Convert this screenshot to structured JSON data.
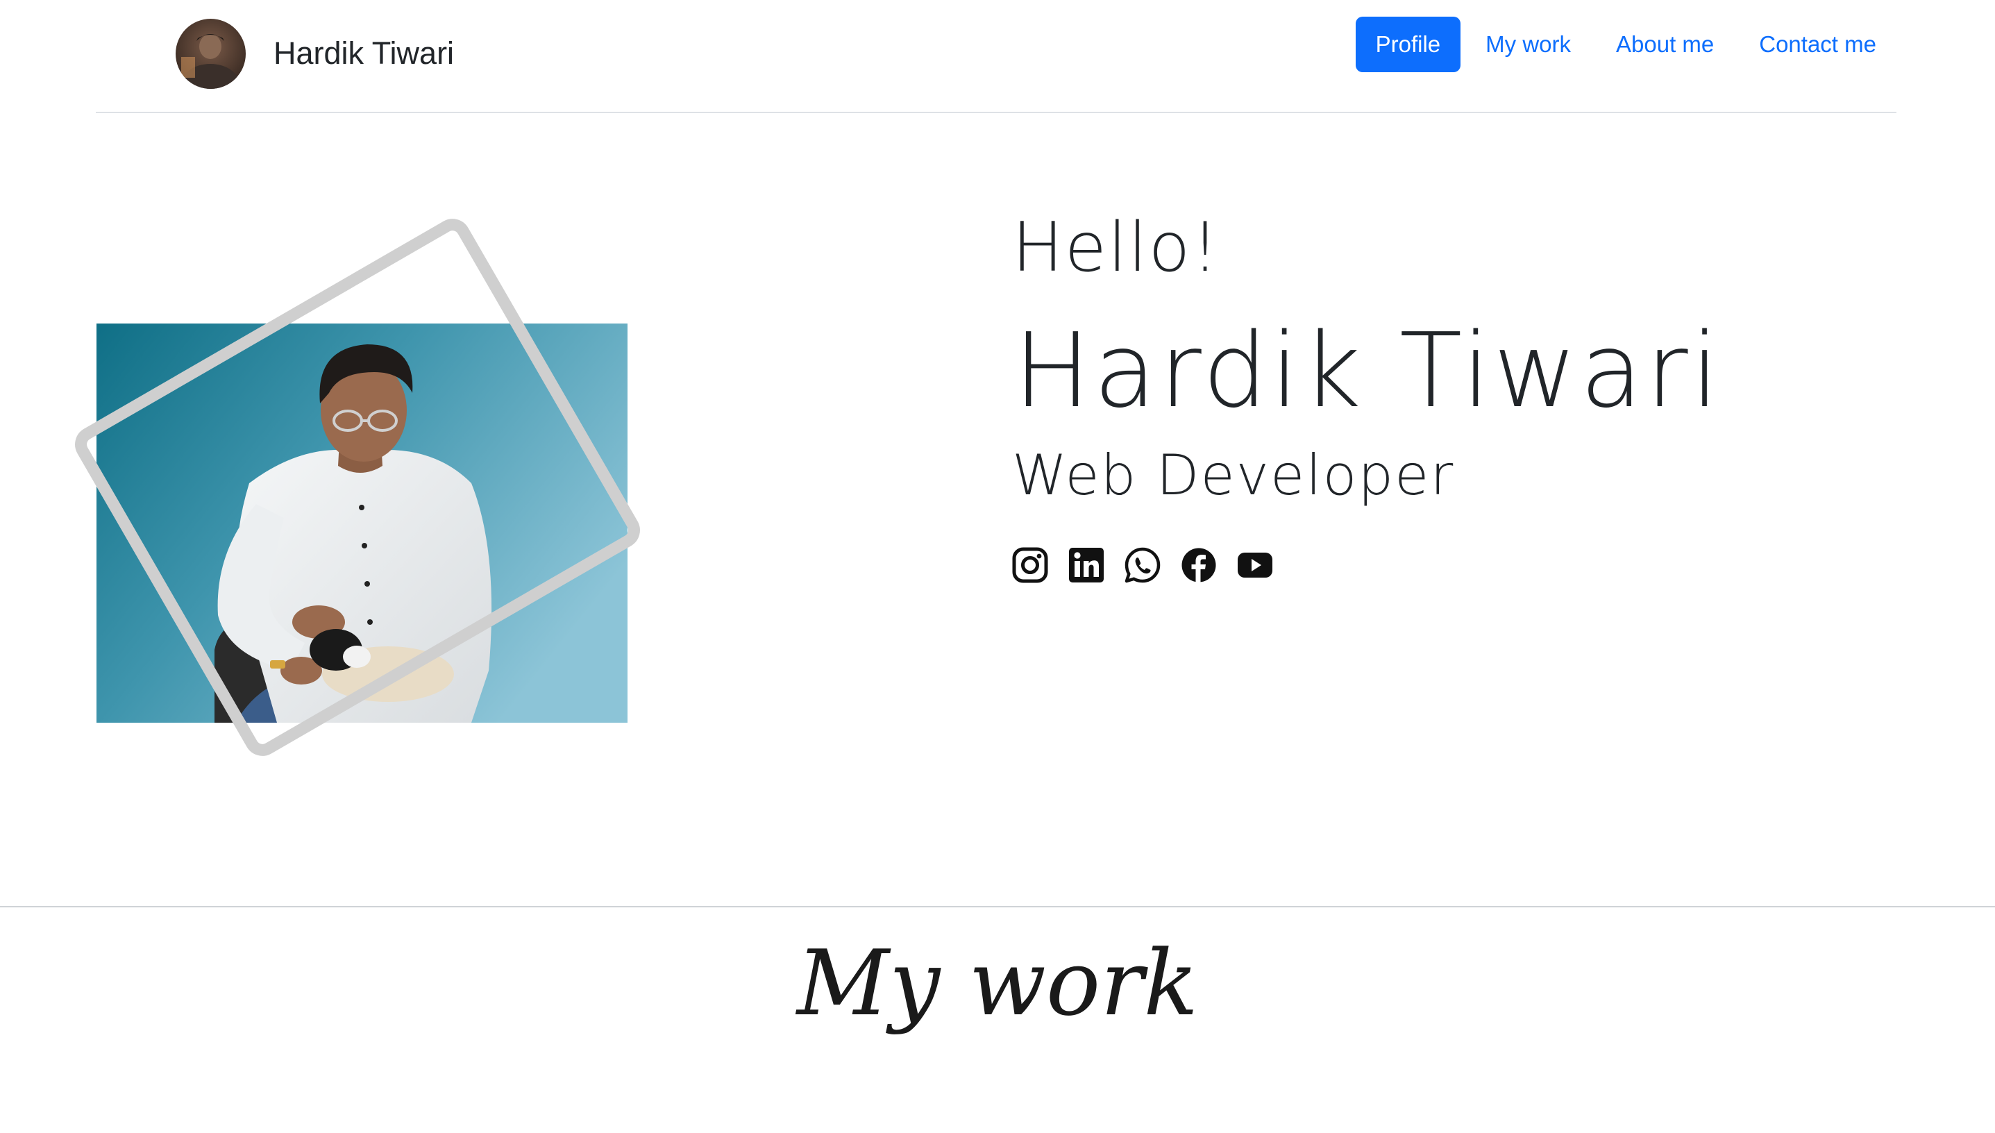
{
  "header": {
    "brand_name": "Hardik Tiwari",
    "nav": [
      {
        "label": "Profile",
        "active": true
      },
      {
        "label": "My work",
        "active": false
      },
      {
        "label": "About me",
        "active": false
      },
      {
        "label": "Contact me",
        "active": false
      }
    ]
  },
  "hero": {
    "greeting": "Hello!",
    "name": "Hardik Tiwari",
    "role": "Web Developer",
    "socials": [
      "instagram-icon",
      "linkedin-icon",
      "whatsapp-icon",
      "facebook-icon",
      "youtube-icon"
    ]
  },
  "sections": {
    "my_work_title": "My work"
  },
  "colors": {
    "accent": "#0d6efd",
    "frame": "#cfcfcf",
    "photo_bg_left": "#0f6f86",
    "photo_bg_right": "#86bfd4"
  }
}
